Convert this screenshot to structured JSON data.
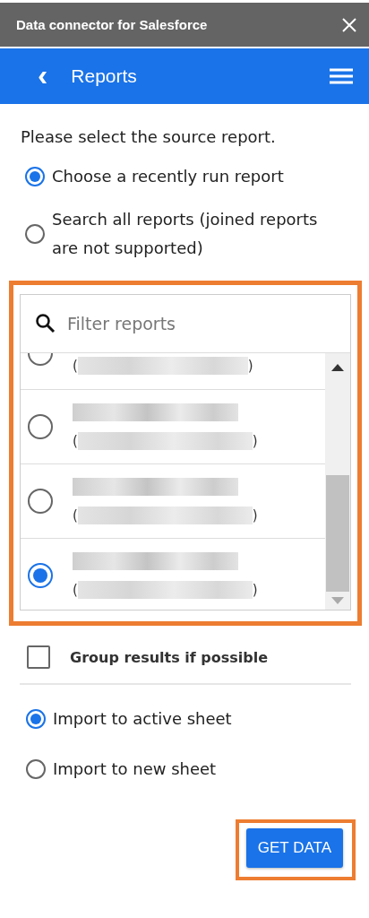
{
  "window": {
    "title": "Data connector for Salesforce"
  },
  "header": {
    "back": "‹",
    "title": "Reports"
  },
  "prompt": "Please select the source report.",
  "source_options": [
    {
      "label": "Choose a recently run report",
      "selected": true
    },
    {
      "label": "Search all reports (joined reports are not supported)",
      "selected": false
    }
  ],
  "search": {
    "placeholder": "Filter reports"
  },
  "reports": [
    {
      "kind": "cut",
      "selected": false,
      "open": "(",
      "close": ")"
    },
    {
      "kind": "full",
      "selected": false,
      "open": "(",
      "close": ")"
    },
    {
      "kind": "full",
      "selected": false,
      "open": "(",
      "close": ")"
    },
    {
      "kind": "full",
      "selected": true,
      "open": "(",
      "close": ")"
    }
  ],
  "group_results": {
    "label": "Group results if possible",
    "checked": false
  },
  "import_options": [
    {
      "label": "Import to active sheet",
      "selected": true
    },
    {
      "label": "Import to new sheet",
      "selected": false
    }
  ],
  "button": "GET DATA"
}
